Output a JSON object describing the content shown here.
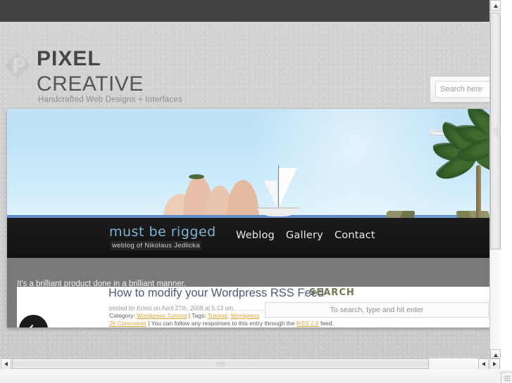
{
  "browser": {
    "scrollbars": {
      "vertical": {
        "name": "vertical-scrollbar",
        "up_arrow": "scroll-up-icon",
        "down_arrow": "scroll-down-icon"
      },
      "horizontal": {
        "name": "horizontal-scrollbar",
        "left_arrow": "scroll-left-icon",
        "right_arrow": "scroll-right-icon"
      }
    }
  },
  "site_header": {
    "logo_icon": "pixel-p-logo-icon",
    "brand_line_1": "PIXEL",
    "brand_line_2": "CREATIVE",
    "tagline": "Handcrafted Web Designs + Interfaces",
    "search": {
      "value": "",
      "placeholder": "Search here",
      "icon": "search-icon"
    }
  },
  "preview": {
    "slide_caption": "It's a brilliant product done in a brilliant manner.",
    "prev_button_label": "Previous slide",
    "prev_icon": "chevron-left-icon",
    "showcased_site": {
      "logo_text": "must be rigged",
      "logo_subtitle": "weblog of Nikolaus Jedlicka",
      "nav": [
        {
          "label": "Weblog"
        },
        {
          "label": "Gallery"
        },
        {
          "label": "Contact"
        }
      ],
      "post": {
        "title": "How to modify your Wordpress RSS Feed",
        "byline": "posted by Kriesi on April 27th, 2008 at 5:13 pm",
        "meta_prefix": "Category:",
        "meta_category": "Wordpress Tutorial",
        "meta_sep": "|",
        "meta_tags_label": "Tags:",
        "meta_tag_1": "Tutorial",
        "meta_tag_comma": ",",
        "meta_tag_2": "Wordpress",
        "comments_link": "26 Comments",
        "comments_sep": "|",
        "comments_text_before": "You can follow any responses to this entry through the",
        "rss_link": "RSS 2.0",
        "comments_text_after": "feed."
      },
      "sidebar_search": {
        "heading": "SEARCH",
        "placeholder": "To search, type and hit enter",
        "value": ""
      }
    }
  },
  "colors": {
    "page_bg": "#d2d2d2",
    "top_bar": "#434343",
    "navbar": "#1b1b1b",
    "scrim": "#5c5c5c",
    "link_accent": "#e3a53a",
    "post_title": "#4e5a7a",
    "brand_text": "#4a4a4a",
    "mbr_logo": "#7fb3d5"
  }
}
